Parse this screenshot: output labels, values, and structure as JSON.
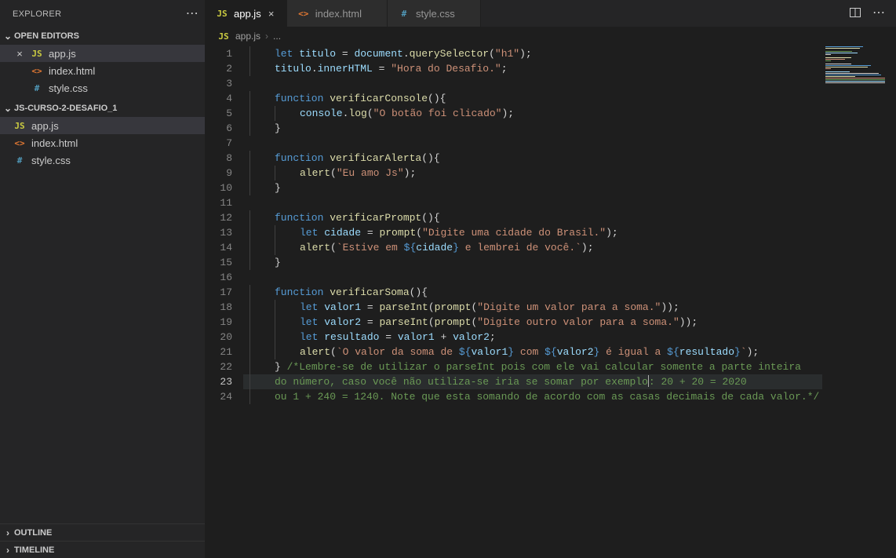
{
  "sidebar": {
    "title": "EXPLORER",
    "open_editors_label": "OPEN EDITORS",
    "folder_label": "JS-CURSO-2-DESAFIO_1",
    "outline_label": "OUTLINE",
    "timeline_label": "TIMELINE",
    "open_editors": [
      {
        "name": "app.js",
        "icon": "JS",
        "icon_class": "ic-js",
        "active": true,
        "closable": true
      },
      {
        "name": "index.html",
        "icon": "<>",
        "icon_class": "ic-html",
        "active": false,
        "closable": false
      },
      {
        "name": "style.css",
        "icon": "#",
        "icon_class": "ic-css",
        "active": false,
        "closable": false
      }
    ],
    "files": [
      {
        "name": "app.js",
        "icon": "JS",
        "icon_class": "ic-js",
        "active": true
      },
      {
        "name": "index.html",
        "icon": "<>",
        "icon_class": "ic-html",
        "active": false
      },
      {
        "name": "style.css",
        "icon": "#",
        "icon_class": "ic-css",
        "active": false
      }
    ]
  },
  "tabs": [
    {
      "name": "app.js",
      "icon": "JS",
      "icon_class": "ic-js",
      "active": true
    },
    {
      "name": "index.html",
      "icon": "<>",
      "icon_class": "ic-html",
      "active": false
    },
    {
      "name": "style.css",
      "icon": "#",
      "icon_class": "ic-css",
      "active": false
    }
  ],
  "breadcrumb": {
    "icon": "JS",
    "file": "app.js",
    "tail": "..."
  },
  "editor": {
    "current_line": 23,
    "cursor_col_after": "exemplo",
    "line_count": 24,
    "lines": [
      {
        "n": 1,
        "indent": 1,
        "tokens": [
          [
            "k",
            "let "
          ],
          [
            "v",
            "titulo"
          ],
          [
            "d",
            " = "
          ],
          [
            "v",
            "document"
          ],
          [
            "d",
            "."
          ],
          [
            "fn",
            "querySelector"
          ],
          [
            "d",
            "("
          ],
          [
            "s",
            "\"h1\""
          ],
          [
            "d",
            ");"
          ]
        ]
      },
      {
        "n": 2,
        "indent": 1,
        "tokens": [
          [
            "v",
            "titulo"
          ],
          [
            "d",
            "."
          ],
          [
            "p",
            "innerHTML"
          ],
          [
            "d",
            " = "
          ],
          [
            "s",
            "\"Hora do Desafio.\""
          ],
          [
            "d",
            ";"
          ]
        ]
      },
      {
        "n": 3,
        "indent": 0,
        "tokens": []
      },
      {
        "n": 4,
        "indent": 1,
        "tokens": [
          [
            "k",
            "function "
          ],
          [
            "fn",
            "verificarConsole"
          ],
          [
            "d",
            "(){"
          ]
        ]
      },
      {
        "n": 5,
        "indent": 2,
        "tokens": [
          [
            "v",
            "console"
          ],
          [
            "d",
            "."
          ],
          [
            "fn",
            "log"
          ],
          [
            "d",
            "("
          ],
          [
            "s",
            "\"O botão foi clicado\""
          ],
          [
            "d",
            ");"
          ]
        ]
      },
      {
        "n": 6,
        "indent": 1,
        "tokens": [
          [
            "d",
            "}"
          ]
        ]
      },
      {
        "n": 7,
        "indent": 0,
        "tokens": []
      },
      {
        "n": 8,
        "indent": 1,
        "tokens": [
          [
            "k",
            "function "
          ],
          [
            "fn",
            "verificarAlerta"
          ],
          [
            "d",
            "(){"
          ]
        ]
      },
      {
        "n": 9,
        "indent": 2,
        "tokens": [
          [
            "fn",
            "alert"
          ],
          [
            "d",
            "("
          ],
          [
            "s",
            "\"Eu amo Js\""
          ],
          [
            "d",
            ");"
          ]
        ]
      },
      {
        "n": 10,
        "indent": 1,
        "tokens": [
          [
            "d",
            "}"
          ]
        ]
      },
      {
        "n": 11,
        "indent": 0,
        "tokens": []
      },
      {
        "n": 12,
        "indent": 1,
        "tokens": [
          [
            "k",
            "function "
          ],
          [
            "fn",
            "verificarPrompt"
          ],
          [
            "d",
            "(){"
          ]
        ]
      },
      {
        "n": 13,
        "indent": 2,
        "tokens": [
          [
            "k",
            "let "
          ],
          [
            "v",
            "cidade"
          ],
          [
            "d",
            " = "
          ],
          [
            "fn",
            "prompt"
          ],
          [
            "d",
            "("
          ],
          [
            "s",
            "\"Digite uma cidade do Brasil.\""
          ],
          [
            "d",
            ");"
          ]
        ]
      },
      {
        "n": 14,
        "indent": 2,
        "tokens": [
          [
            "fn",
            "alert"
          ],
          [
            "d",
            "("
          ],
          [
            "s",
            "`Estive em "
          ],
          [
            "tmp",
            "${"
          ],
          [
            "v",
            "cidade"
          ],
          [
            "tmp",
            "}"
          ],
          [
            "s",
            " e lembrei de você.`"
          ],
          [
            "d",
            ");"
          ]
        ]
      },
      {
        "n": 15,
        "indent": 1,
        "tokens": [
          [
            "d",
            "}"
          ]
        ]
      },
      {
        "n": 16,
        "indent": 0,
        "tokens": []
      },
      {
        "n": 17,
        "indent": 1,
        "tokens": [
          [
            "k",
            "function "
          ],
          [
            "fn",
            "verificarSoma"
          ],
          [
            "d",
            "(){"
          ]
        ]
      },
      {
        "n": 18,
        "indent": 2,
        "tokens": [
          [
            "k",
            "let "
          ],
          [
            "v",
            "valor1"
          ],
          [
            "d",
            " = "
          ],
          [
            "fn",
            "parseInt"
          ],
          [
            "d",
            "("
          ],
          [
            "fn",
            "prompt"
          ],
          [
            "d",
            "("
          ],
          [
            "s",
            "\"Digite um valor para a soma.\""
          ],
          [
            "d",
            "));"
          ]
        ]
      },
      {
        "n": 19,
        "indent": 2,
        "tokens": [
          [
            "k",
            "let "
          ],
          [
            "v",
            "valor2"
          ],
          [
            "d",
            " = "
          ],
          [
            "fn",
            "parseInt"
          ],
          [
            "d",
            "("
          ],
          [
            "fn",
            "prompt"
          ],
          [
            "d",
            "("
          ],
          [
            "s",
            "\"Digite outro valor para a soma.\""
          ],
          [
            "d",
            "));"
          ]
        ]
      },
      {
        "n": 20,
        "indent": 2,
        "tokens": [
          [
            "k",
            "let "
          ],
          [
            "v",
            "resultado"
          ],
          [
            "d",
            " = "
          ],
          [
            "v",
            "valor1"
          ],
          [
            "d",
            " + "
          ],
          [
            "v",
            "valor2"
          ],
          [
            "d",
            ";"
          ]
        ]
      },
      {
        "n": 21,
        "indent": 2,
        "tokens": [
          [
            "fn",
            "alert"
          ],
          [
            "d",
            "("
          ],
          [
            "s",
            "`O valor da soma de "
          ],
          [
            "tmp",
            "${"
          ],
          [
            "v",
            "valor1"
          ],
          [
            "tmp",
            "}"
          ],
          [
            "s",
            " com "
          ],
          [
            "tmp",
            "${"
          ],
          [
            "v",
            "valor2"
          ],
          [
            "tmp",
            "}"
          ],
          [
            "s",
            " é igual a "
          ],
          [
            "tmp",
            "${"
          ],
          [
            "v",
            "resultado"
          ],
          [
            "tmp",
            "}"
          ],
          [
            "s",
            "`"
          ],
          [
            "d",
            ");"
          ]
        ]
      },
      {
        "n": 22,
        "indent": 1,
        "tokens": [
          [
            "d",
            "} "
          ],
          [
            "c",
            "/*Lembre-se de utilizar o parseInt pois com ele vai calcular somente a parte inteira"
          ]
        ]
      },
      {
        "n": 23,
        "indent": 1,
        "tokens": [
          [
            "c",
            "do número, caso você não utiliza-se iria se somar por exemplo"
          ],
          [
            "cursor",
            ""
          ],
          [
            "c",
            ": 20 + 20 = 2020"
          ]
        ]
      },
      {
        "n": 24,
        "indent": 1,
        "tokens": [
          [
            "c",
            "ou 1 + 240 = 1240. Note que esta somando de acordo com as casas decimais de cada valor.*/"
          ]
        ]
      }
    ]
  },
  "colors": {
    "bg": "#1e1e1e",
    "sidebar": "#252526",
    "accent": "#007acc"
  }
}
